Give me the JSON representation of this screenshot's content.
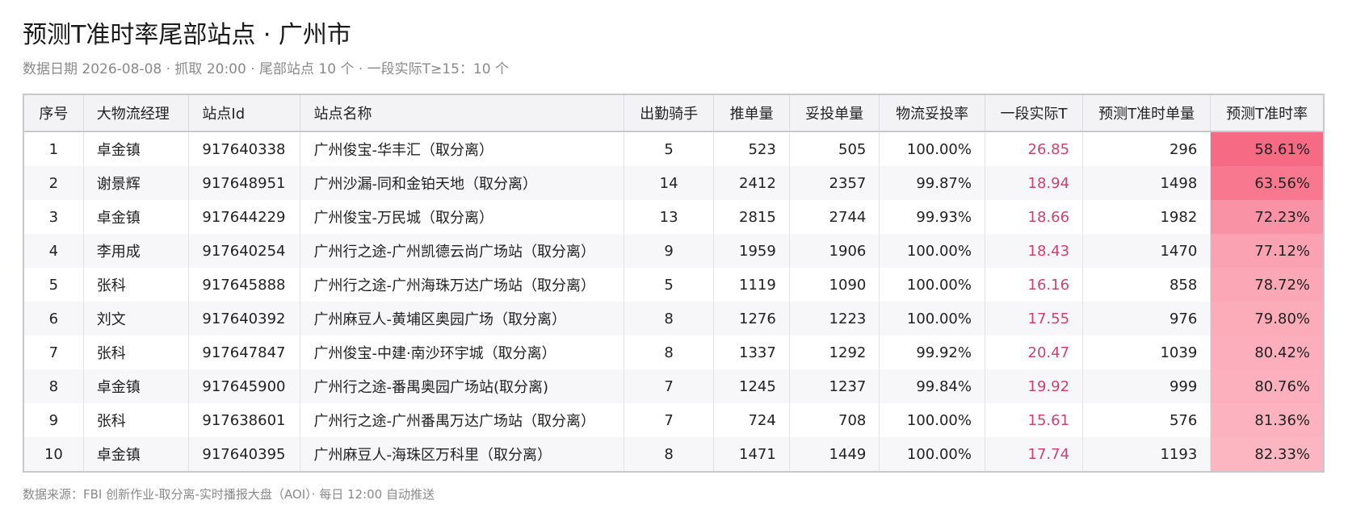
{
  "header": {
    "title": "预测T准时率尾部站点 · 广州市",
    "subtitle": "数据日期 2026-08-08 · 抓取 20:00 · 尾部站点 10 个 · 一段实际T≥15：10 个"
  },
  "table": {
    "columns": [
      "序号",
      "大物流经理",
      "站点Id",
      "站点名称",
      "出勤骑手",
      "推单量",
      "妥投单量",
      "物流妥投率",
      "一段实际T",
      "预测T准时单量",
      "预测T准时率"
    ],
    "rows": [
      {
        "no": "1",
        "manager": "卓金镇",
        "id": "917640338",
        "name": "广州俊宝-华丰汇（取分离）",
        "riders": "5",
        "push": "523",
        "delivered": "505",
        "delivery_rate": "100.00%",
        "t1": "26.85",
        "ontime_count": "296",
        "ontime_rate": "58.61%",
        "rate_color": "#f66a84"
      },
      {
        "no": "2",
        "manager": "谢景辉",
        "id": "917648951",
        "name": "广州沙漏-同和金铂天地（取分离）",
        "riders": "14",
        "push": "2412",
        "delivered": "2357",
        "delivery_rate": "99.87%",
        "t1": "18.94",
        "ontime_count": "1498",
        "ontime_rate": "63.56%",
        "rate_color": "#f87890"
      },
      {
        "no": "3",
        "manager": "卓金镇",
        "id": "917644229",
        "name": "广州俊宝-万民城（取分离）",
        "riders": "13",
        "push": "2815",
        "delivered": "2744",
        "delivery_rate": "99.93%",
        "t1": "18.66",
        "ontime_count": "1982",
        "ontime_rate": "72.23%",
        "rate_color": "#fa92a5"
      },
      {
        "no": "4",
        "manager": "李用成",
        "id": "917640254",
        "name": "广州行之途-广州凯德云尚广场站（取分离）",
        "riders": "9",
        "push": "1959",
        "delivered": "1906",
        "delivery_rate": "100.00%",
        "t1": "18.43",
        "ontime_count": "1470",
        "ontime_rate": "77.12%",
        "rate_color": "#fba2b2"
      },
      {
        "no": "5",
        "manager": "张科",
        "id": "917645888",
        "name": "广州行之途-广州海珠万达广场站（取分离）",
        "riders": "5",
        "push": "1119",
        "delivered": "1090",
        "delivery_rate": "100.00%",
        "t1": "16.16",
        "ontime_count": "858",
        "ontime_rate": "78.72%",
        "rate_color": "#fba7b6"
      },
      {
        "no": "6",
        "manager": "刘文",
        "id": "917640392",
        "name": "广州麻豆人-黄埔区奥园广场（取分离）",
        "riders": "8",
        "push": "1276",
        "delivered": "1223",
        "delivery_rate": "100.00%",
        "t1": "17.55",
        "ontime_count": "976",
        "ontime_rate": "79.80%",
        "rate_color": "#fcabb9"
      },
      {
        "no": "7",
        "manager": "张科",
        "id": "917647847",
        "name": "广州俊宝-中建·南沙环宇城（取分离）",
        "riders": "8",
        "push": "1337",
        "delivered": "1292",
        "delivery_rate": "99.92%",
        "t1": "20.47",
        "ontime_count": "1039",
        "ontime_rate": "80.42%",
        "rate_color": "#fcaebc"
      },
      {
        "no": "8",
        "manager": "卓金镇",
        "id": "917645900",
        "name": "广州行之途-番禺奥园广场站(取分离)",
        "riders": "7",
        "push": "1245",
        "delivered": "1237",
        "delivery_rate": "99.84%",
        "t1": "19.92",
        "ontime_count": "999",
        "ontime_rate": "80.76%",
        "rate_color": "#fcafbd"
      },
      {
        "no": "9",
        "manager": "张科",
        "id": "917638601",
        "name": "广州行之途-广州番禺万达广场站（取分离）",
        "riders": "7",
        "push": "724",
        "delivered": "708",
        "delivery_rate": "100.00%",
        "t1": "15.61",
        "ontime_count": "576",
        "ontime_rate": "81.36%",
        "rate_color": "#fcb2bf"
      },
      {
        "no": "10",
        "manager": "卓金镇",
        "id": "917640395",
        "name": "广州麻豆人-海珠区万科里（取分离）",
        "riders": "8",
        "push": "1471",
        "delivered": "1449",
        "delivery_rate": "100.00%",
        "t1": "17.74",
        "ontime_count": "1193",
        "ontime_rate": "82.33%",
        "rate_color": "#fcb6c2"
      }
    ]
  },
  "footer": {
    "source": "数据来源：FBI 创新作业-取分离-实时播报大盘（AOI）· 每日 12:00 自动推送"
  },
  "colors": {
    "t1_text": "#d0416b",
    "header_bg": "#f3f3f6"
  }
}
